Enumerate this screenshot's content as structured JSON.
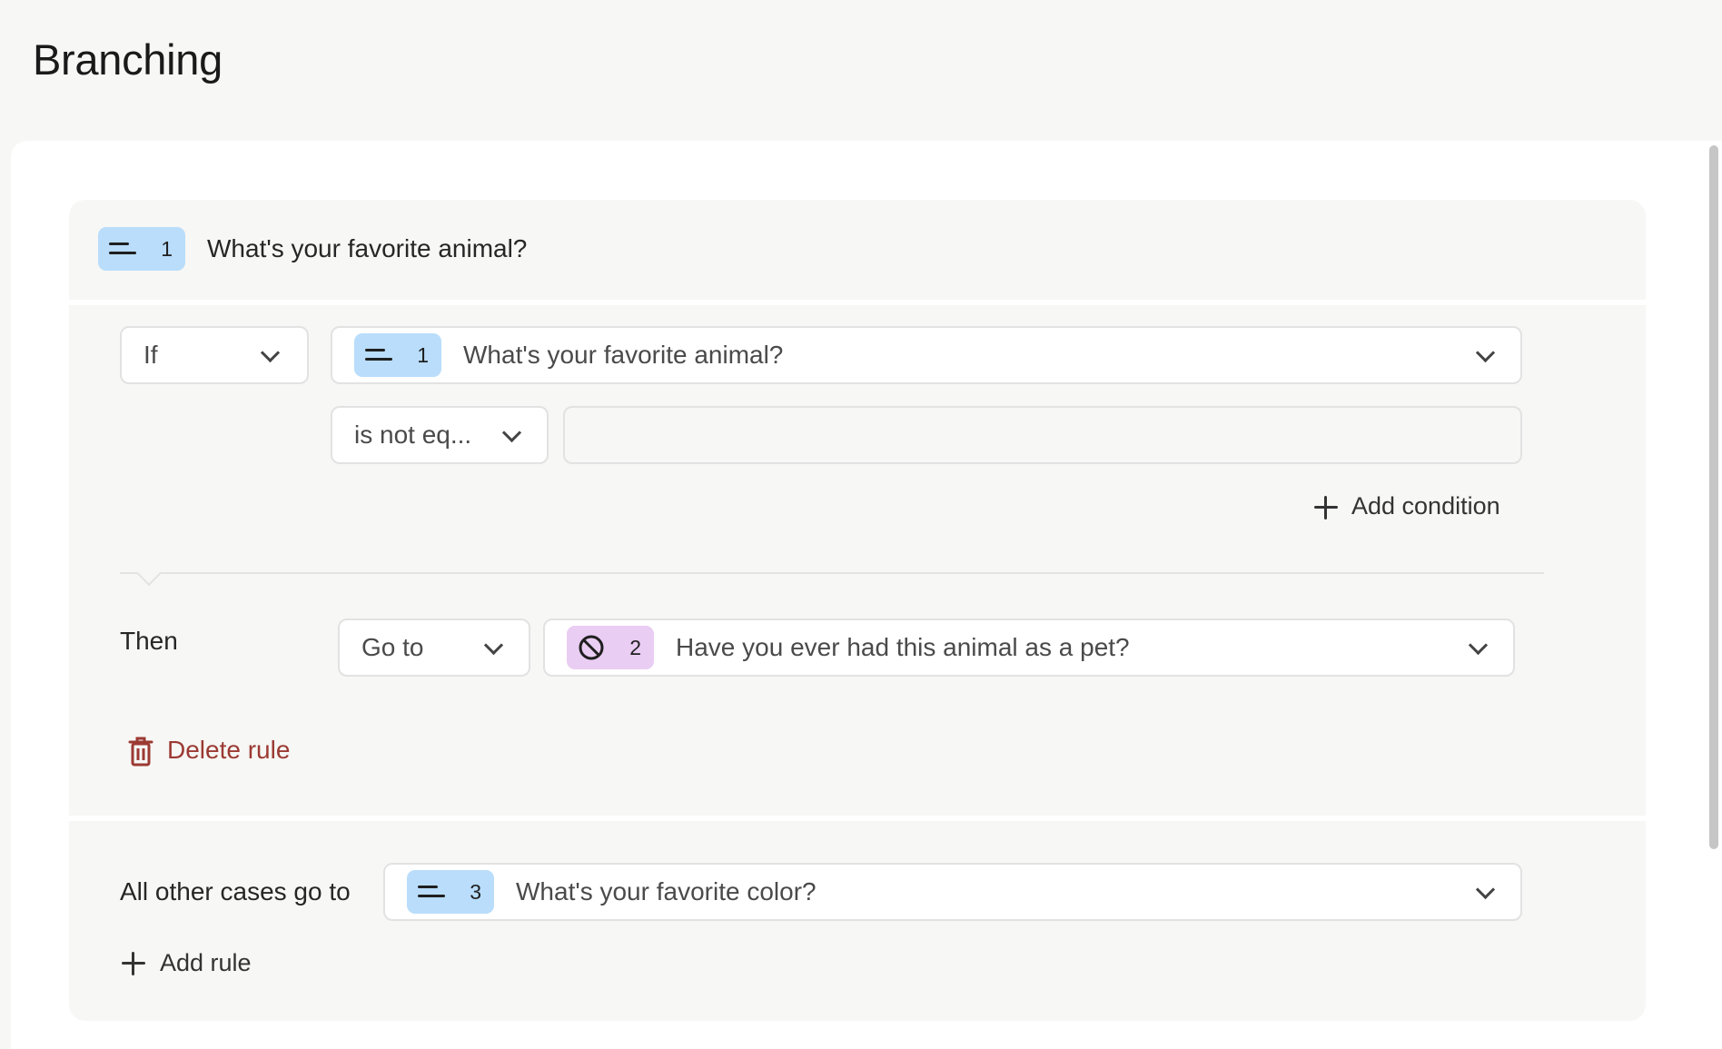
{
  "page": {
    "title": "Branching"
  },
  "question": {
    "number": "1",
    "title": "What's your favorite animal?",
    "icon": "short-text-icon",
    "badge_color": "#b9ddfb"
  },
  "rule": {
    "if_operator": "If",
    "condition_question": {
      "number": "1",
      "title": "What's your favorite animal?",
      "icon": "short-text-icon"
    },
    "comparator": "is not eq...",
    "condition_value": "",
    "add_condition_label": "Add condition",
    "then_label": "Then",
    "action": "Go to",
    "target_question": {
      "number": "2",
      "title": "Have you ever had this animal as a pet?",
      "icon": "blocked-icon",
      "badge_color": "#e9cdf3"
    },
    "delete_label": "Delete rule",
    "delete_color": "#9b3a33"
  },
  "fallback": {
    "label": "All other cases go to",
    "target_question": {
      "number": "3",
      "title": "What's your favorite color?",
      "icon": "short-text-icon"
    }
  },
  "add_rule_label": "Add rule"
}
